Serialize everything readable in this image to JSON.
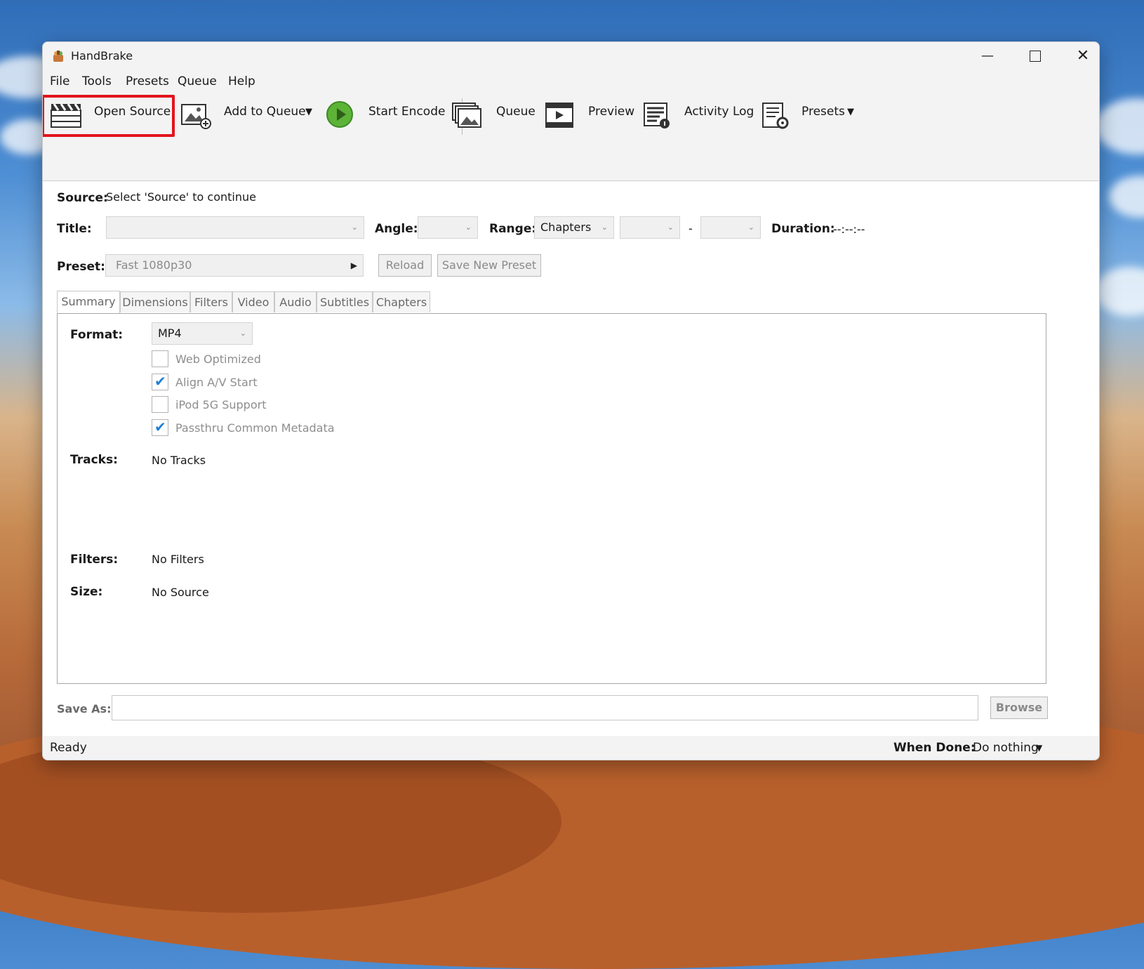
{
  "window": {
    "title": "HandBrake"
  },
  "menu": [
    "File",
    "Tools",
    "Presets",
    "Queue",
    "Help"
  ],
  "toolbar": {
    "open_source": "Open Source",
    "add_to_queue": "Add to Queue",
    "start_encode": "Start Encode",
    "queue": "Queue",
    "preview": "Preview",
    "activity_log": "Activity Log",
    "presets": "Presets"
  },
  "source": {
    "label": "Source:",
    "value": "Select 'Source' to continue"
  },
  "title_row": {
    "title_label": "Title:",
    "title_value": "",
    "angle_label": "Angle:",
    "angle_value": "",
    "range_label": "Range:",
    "range_value": "Chapters",
    "range_start": "",
    "range_dash": "-",
    "range_end": "",
    "duration_label": "Duration:",
    "duration_value": "--:--:--"
  },
  "preset_row": {
    "label": "Preset:",
    "value": "Fast 1080p30",
    "reload": "Reload",
    "save_new_preset": "Save New Preset"
  },
  "tabs": [
    "Summary",
    "Dimensions",
    "Filters",
    "Video",
    "Audio",
    "Subtitles",
    "Chapters"
  ],
  "summary": {
    "format_label": "Format:",
    "format_value": "MP4",
    "options": [
      {
        "label": "Web Optimized",
        "checked": false
      },
      {
        "label": "Align A/V Start",
        "checked": true
      },
      {
        "label": "iPod 5G Support",
        "checked": false
      },
      {
        "label": "Passthru Common Metadata",
        "checked": true
      }
    ],
    "tracks_label": "Tracks:",
    "tracks_value": "No Tracks",
    "filters_label": "Filters:",
    "filters_value": "No Filters",
    "size_label": "Size:",
    "size_value": "No Source"
  },
  "save_as": {
    "label": "Save As:",
    "value": "",
    "browse": "Browse"
  },
  "status": {
    "text": "Ready",
    "when_done_label": "When Done:",
    "when_done_value": "Do nothing"
  },
  "colors": {
    "highlight": "#e3141d",
    "check": "#1f7fd6",
    "play": "#5cb338"
  }
}
